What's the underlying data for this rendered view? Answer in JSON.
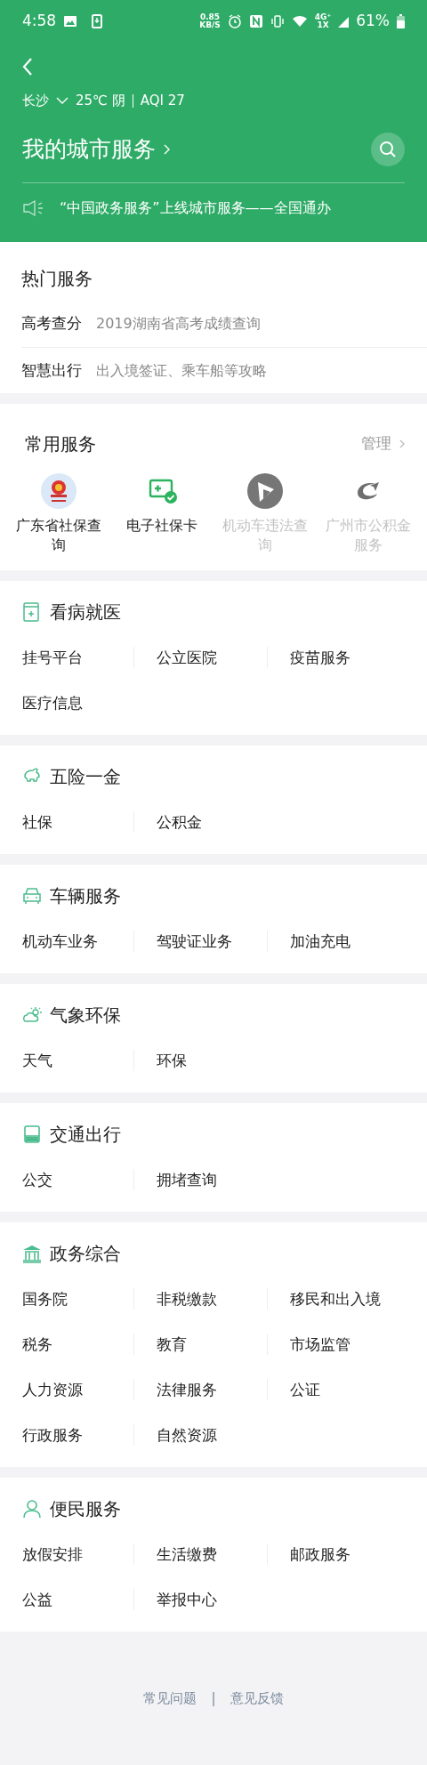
{
  "status_bar": {
    "time": "4:58",
    "net_speed": "0.85",
    "net_unit": "KB/S",
    "network_type": "4G⁺",
    "network_type_2": "1X",
    "battery": "61%"
  },
  "header": {
    "city": "长沙",
    "weather": "25℃ 阴",
    "aqi": "AQI 27",
    "title": "我的城市服务",
    "notice": "“中国政务服务”上线城市服务——全国通办"
  },
  "hot_services": {
    "title": "热门服务",
    "items": [
      {
        "label": "高考查分",
        "description": "2019湖南省高考成绩查询"
      },
      {
        "label": "智慧出行",
        "description": "出入境签证、乘车船等攻略"
      }
    ]
  },
  "common_services": {
    "title": "常用服务",
    "manage": "管理",
    "items": [
      {
        "label": "广东省社保查询",
        "disabled": false
      },
      {
        "label": "电子社保卡",
        "disabled": false
      },
      {
        "label": "机动车违法查询",
        "disabled": true
      },
      {
        "label": "广州市公积金服务",
        "disabled": true
      }
    ]
  },
  "sections": [
    {
      "title": "看病就医",
      "items": [
        "挂号平台",
        "公立医院",
        "疫苗服务",
        "医疗信息"
      ]
    },
    {
      "title": "五险一金",
      "items": [
        "社保",
        "公积金"
      ]
    },
    {
      "title": "车辆服务",
      "items": [
        "机动车业务",
        "驾驶证业务",
        "加油充电"
      ]
    },
    {
      "title": "气象环保",
      "items": [
        "天气",
        "环保"
      ]
    },
    {
      "title": "交通出行",
      "items": [
        "公交",
        "拥堵查询"
      ]
    },
    {
      "title": "政务综合",
      "items": [
        "国务院",
        "非税缴款",
        "移民和出入境",
        "税务",
        "教育",
        "市场监管",
        "人力资源",
        "法律服务",
        "公证",
        "行政服务",
        "自然资源"
      ]
    },
    {
      "title": "便民服务",
      "items": [
        "放假安排",
        "生活缴费",
        "邮政服务",
        "公益",
        "举报中心"
      ]
    }
  ],
  "footer": {
    "links": [
      "常见问题",
      "意见反馈"
    ],
    "separator": "|"
  }
}
